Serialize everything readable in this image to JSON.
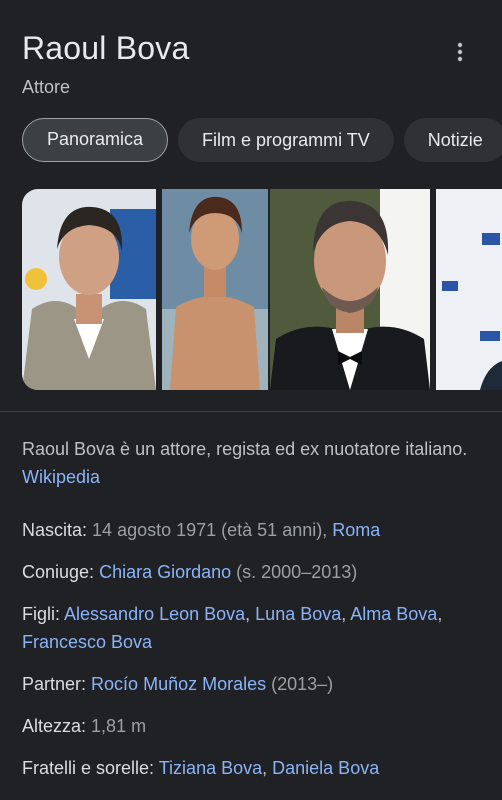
{
  "header": {
    "title": "Raoul Bova",
    "subtitle": "Attore"
  },
  "tabs": [
    {
      "label": "Panoramica",
      "active": true
    },
    {
      "label": "Film e programmi TV",
      "active": false
    },
    {
      "label": "Notizie",
      "active": false
    }
  ],
  "description": {
    "text": "Raoul Bova è un attore, regista ed ex nuotatore italiano. ",
    "source": "Wikipedia"
  },
  "facts": {
    "birth": {
      "label": "Nascita:",
      "value": "14 agosto 1971 (età 51 anni), ",
      "place": "Roma"
    },
    "spouse": {
      "label": "Coniuge:",
      "name": "Chiara Giordano",
      "years": " (s. 2000–2013)"
    },
    "children": {
      "label": "Figli:",
      "names": [
        "Alessandro Leon Bova",
        "Luna Bova",
        "Alma Bova",
        "Francesco Bova"
      ]
    },
    "partner": {
      "label": "Partner:",
      "name": "Rocío Muñoz Morales",
      "years": " (2013–)"
    },
    "height": {
      "label": "Altezza:",
      "value": "1,81 m"
    },
    "siblings": {
      "label": "Fratelli e sorelle:",
      "names": [
        "Tiziana Bova",
        "Daniela Bova"
      ]
    }
  },
  "colors": {
    "background": "#202124",
    "link": "#8ab4f8",
    "text": "#bdc1c6",
    "title": "#e8eaed"
  }
}
